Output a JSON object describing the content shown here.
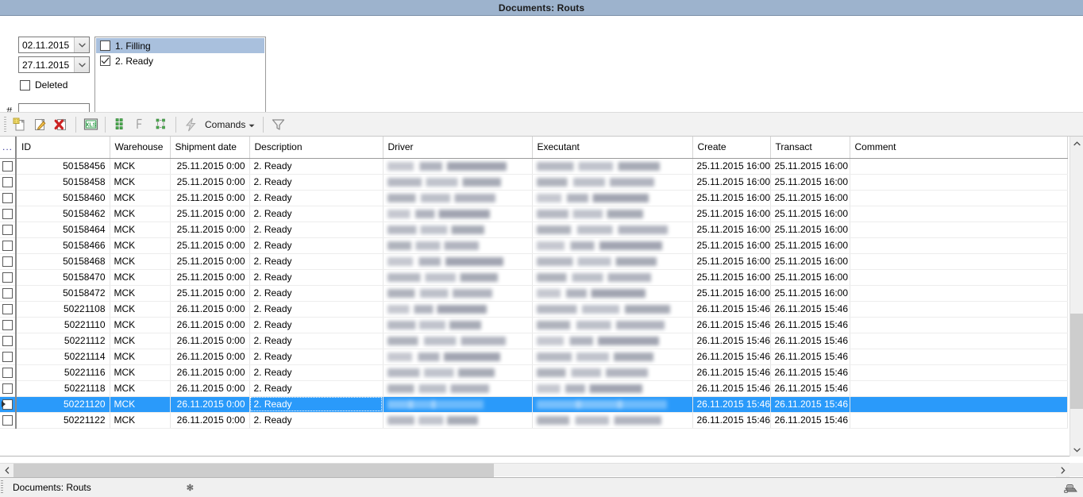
{
  "window": {
    "title": "Documents: Routs"
  },
  "filters": {
    "date_from": "02.11.2015",
    "date_to": "27.11.2015",
    "deleted_label": "Deleted",
    "deleted_checked": false,
    "hash_label": "#",
    "hash_value": "",
    "hash_placeholder": "",
    "status_items": [
      {
        "label": "1. Filling",
        "checked": false,
        "selected": true
      },
      {
        "label": "2. Ready",
        "checked": true,
        "selected": false
      }
    ]
  },
  "toolbar": {
    "new_icon": "new-document-icon",
    "edit_icon": "edit-document-icon",
    "delete_icon": "delete-document-icon",
    "export_icon": "export-xls-icon",
    "expand_icon": "expand-all-icon",
    "collapse_icon": "collapse-all-icon",
    "group_icon": "group-rows-icon",
    "run_icon": "lightning-icon",
    "commands_label": "Comands",
    "commands_arrow_icon": "chevron-down-icon",
    "filter_icon": "funnel-filter-icon"
  },
  "grid": {
    "columns": [
      {
        "key": "sel",
        "label": "..."
      },
      {
        "key": "id",
        "label": "ID"
      },
      {
        "key": "warehouse",
        "label": "Warehouse"
      },
      {
        "key": "shipment",
        "label": "Shipment date"
      },
      {
        "key": "desc",
        "label": "Description"
      },
      {
        "key": "driver",
        "label": "Driver"
      },
      {
        "key": "executant",
        "label": "Executant"
      },
      {
        "key": "create",
        "label": "Create"
      },
      {
        "key": "transact",
        "label": "Transact"
      },
      {
        "key": "comment",
        "label": "Comment"
      }
    ],
    "rows": [
      {
        "id": "50158456",
        "warehouse": "MCK",
        "shipment": "25.11.2015 0:00",
        "desc": "2. Ready",
        "driver": "",
        "executant": "",
        "create": "25.11.2015 16:00",
        "transact": "25.11.2015 16:00",
        "comment": "",
        "selected": false,
        "checked": false
      },
      {
        "id": "50158458",
        "warehouse": "MCK",
        "shipment": "25.11.2015 0:00",
        "desc": "2. Ready",
        "driver": "",
        "executant": "",
        "create": "25.11.2015 16:00",
        "transact": "25.11.2015 16:00",
        "comment": "",
        "selected": false,
        "checked": false
      },
      {
        "id": "50158460",
        "warehouse": "MCK",
        "shipment": "25.11.2015 0:00",
        "desc": "2. Ready",
        "driver": "",
        "executant": "",
        "create": "25.11.2015 16:00",
        "transact": "25.11.2015 16:00",
        "comment": "",
        "selected": false,
        "checked": false
      },
      {
        "id": "50158462",
        "warehouse": "MCK",
        "shipment": "25.11.2015 0:00",
        "desc": "2. Ready",
        "driver": "",
        "executant": "",
        "create": "25.11.2015 16:00",
        "transact": "25.11.2015 16:00",
        "comment": "",
        "selected": false,
        "checked": false
      },
      {
        "id": "50158464",
        "warehouse": "MCK",
        "shipment": "25.11.2015 0:00",
        "desc": "2. Ready",
        "driver": "",
        "executant": "",
        "create": "25.11.2015 16:00",
        "transact": "25.11.2015 16:00",
        "comment": "",
        "selected": false,
        "checked": false
      },
      {
        "id": "50158466",
        "warehouse": "MCK",
        "shipment": "25.11.2015 0:00",
        "desc": "2. Ready",
        "driver": "",
        "executant": "",
        "create": "25.11.2015 16:00",
        "transact": "25.11.2015 16:00",
        "comment": "",
        "selected": false,
        "checked": false
      },
      {
        "id": "50158468",
        "warehouse": "MCK",
        "shipment": "25.11.2015 0:00",
        "desc": "2. Ready",
        "driver": "",
        "executant": "",
        "create": "25.11.2015 16:00",
        "transact": "25.11.2015 16:00",
        "comment": "",
        "selected": false,
        "checked": false
      },
      {
        "id": "50158470",
        "warehouse": "MCK",
        "shipment": "25.11.2015 0:00",
        "desc": "2. Ready",
        "driver": "",
        "executant": "",
        "create": "25.11.2015 16:00",
        "transact": "25.11.2015 16:00",
        "comment": "",
        "selected": false,
        "checked": false
      },
      {
        "id": "50158472",
        "warehouse": "MCK",
        "shipment": "25.11.2015 0:00",
        "desc": "2. Ready",
        "driver": "",
        "executant": "",
        "create": "25.11.2015 16:00",
        "transact": "25.11.2015 16:00",
        "comment": "",
        "selected": false,
        "checked": false
      },
      {
        "id": "50221108",
        "warehouse": "MCK",
        "shipment": "26.11.2015 0:00",
        "desc": "2. Ready",
        "driver": "",
        "executant": "",
        "create": "26.11.2015 15:46",
        "transact": "26.11.2015 15:46",
        "comment": "",
        "selected": false,
        "checked": false
      },
      {
        "id": "50221110",
        "warehouse": "MCK",
        "shipment": "26.11.2015 0:00",
        "desc": "2. Ready",
        "driver": "",
        "executant": "",
        "create": "26.11.2015 15:46",
        "transact": "26.11.2015 15:46",
        "comment": "",
        "selected": false,
        "checked": false
      },
      {
        "id": "50221112",
        "warehouse": "MCK",
        "shipment": "26.11.2015 0:00",
        "desc": "2. Ready",
        "driver": "",
        "executant": "",
        "create": "26.11.2015 15:46",
        "transact": "26.11.2015 15:46",
        "comment": "",
        "selected": false,
        "checked": false
      },
      {
        "id": "50221114",
        "warehouse": "MCK",
        "shipment": "26.11.2015 0:00",
        "desc": "2. Ready",
        "driver": "",
        "executant": "",
        "create": "26.11.2015 15:46",
        "transact": "26.11.2015 15:46",
        "comment": "",
        "selected": false,
        "checked": false
      },
      {
        "id": "50221116",
        "warehouse": "MCK",
        "shipment": "26.11.2015 0:00",
        "desc": "2. Ready",
        "driver": "",
        "executant": "",
        "create": "26.11.2015 15:46",
        "transact": "26.11.2015 15:46",
        "comment": "",
        "selected": false,
        "checked": false
      },
      {
        "id": "50221118",
        "warehouse": "MCK",
        "shipment": "26.11.2015 0:00",
        "desc": "2. Ready",
        "driver": "",
        "executant": "",
        "create": "26.11.2015 15:46",
        "transact": "26.11.2015 15:46",
        "comment": "",
        "selected": false,
        "checked": false
      },
      {
        "id": "50221120",
        "warehouse": "MCK",
        "shipment": "26.11.2015 0:00",
        "desc": "2. Ready",
        "driver": "",
        "executant": "",
        "create": "26.11.2015 15:46",
        "transact": "26.11.2015 15:46",
        "comment": "",
        "selected": true,
        "checked": false
      },
      {
        "id": "50221122",
        "warehouse": "MCK",
        "shipment": "26.11.2015 0:00",
        "desc": "2. Ready",
        "driver": "",
        "executant": "",
        "create": "26.11.2015 15:46",
        "transact": "26.11.2015 15:46",
        "comment": "",
        "selected": false,
        "checked": false
      }
    ]
  },
  "taskbar": {
    "item_label": "Documents: Routs",
    "close_glyph": "✻",
    "tray_icon": "printer-icon"
  },
  "colors": {
    "titlebar": "#9db3cd",
    "selection": "#2a9afa",
    "list_selection": "#a9c0dd",
    "toolbar_bg": "#f2f2f2",
    "scroll_thumb": "#cdcdcd"
  }
}
